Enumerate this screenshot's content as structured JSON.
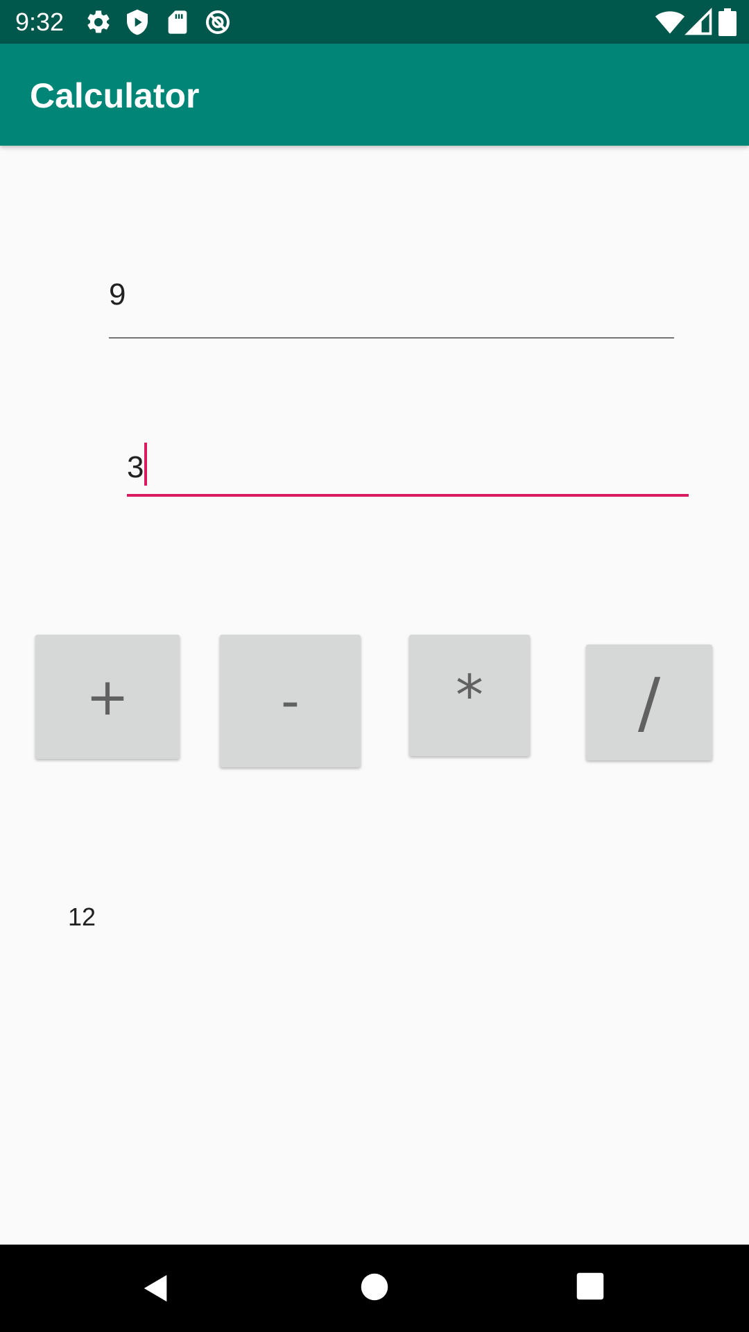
{
  "status_bar": {
    "time": "9:32",
    "left_icons": [
      "settings-icon",
      "play-protect-icon",
      "sd-card-icon",
      "do-not-disturb-icon"
    ],
    "right_icons": [
      "wifi-icon",
      "signal-icon",
      "battery-icon"
    ],
    "background_color": "#00574b"
  },
  "app_bar": {
    "title": "Calculator",
    "background_color": "#008577"
  },
  "inputs": {
    "first": {
      "value": "9",
      "focused": false
    },
    "second": {
      "value": "3",
      "focused": true
    }
  },
  "operators": [
    {
      "label": "+"
    },
    {
      "label": "-"
    },
    {
      "label": "*"
    },
    {
      "label": "/"
    }
  ],
  "result": {
    "text": "12"
  },
  "nav_bar": {
    "icons": [
      "back-icon",
      "home-icon",
      "recents-icon"
    ]
  },
  "colors": {
    "accent": "#d81b60",
    "button_bg": "#d6d7d7",
    "button_text": "#616161",
    "text_primary": "#212121"
  }
}
